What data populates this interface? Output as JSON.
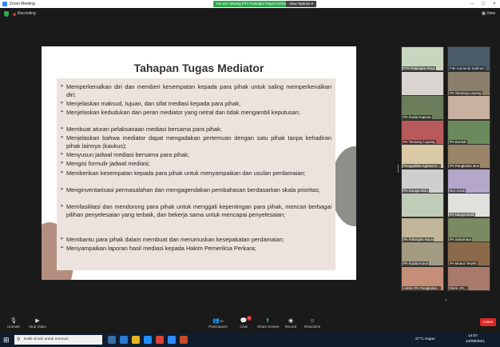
{
  "window": {
    "title": "Zoom Meeting",
    "banner": "You are viewing PTA Palangka Raya's screen",
    "view_options": "View Options",
    "recording": "Recording",
    "view": "View"
  },
  "slide": {
    "title": "Tahapan Tugas Mediator",
    "bullets": [
      "Memperkenalkan diri dan memberi kesempatan kepada para pihak untuk saling memperkenalkan diri;",
      "Menjelaskan maksud, tujuan, dan sifat mediasi kepada para pihak;",
      "Menjelaskan kedudukan dan peran mediator yang netral dan tidak mengambil keputusan;",
      "Membuat aturan pelaksanaan mediasi bersama para pihak;",
      "Menjelaskan bahwa mediator dapat mengadakan pertemuan dengan satu pihak tanpa kehadiran pihak lainnya (kaukus);",
      "Menyusun jadwal mediasi bersama para pihak;",
      "Mengisi formulir jadwal mediasi;",
      "Memberikan kesempatan kepada para pihak untuk menyampaikan dan usulan perdamaian;",
      "Menginventarisasi permasalahan dan mengagendakan pembahasan berdasarkan skala prioritas;",
      "Memfasilitasi dan mendorong para pihak untuk menggali kepentingan para pihak, mencari berbagai pilihan penyelesaian yang terbaik, dan bekerja sama untuk mencapai penyelesaian;",
      "Membantu para pihak dalam membuat dan merumuskan kesepakatan perdamaian;",
      "Menyampaikan laporan hasil mediasi kepada Hakim Pemeriksa Perkara;"
    ]
  },
  "participants": [
    {
      "name": "PTA Palangka Raya",
      "color": "#c8d6c0"
    },
    {
      "name": "Fitri Aumendi Kalimen",
      "color": "#4a5a68"
    },
    {
      "name": "",
      "color": "#d9d4cf"
    },
    {
      "name": "PA Tamiang Layang",
      "color": "#8a7f6a"
    },
    {
      "name": "PA Kuala Kapuas",
      "color": "#6b7d5a"
    },
    {
      "name": "",
      "color": "#c7b19f"
    },
    {
      "name": "PA Tamiang Layang",
      "color": "#b95a5a"
    },
    {
      "name": "PA Buntok",
      "color": "#6b8a5b"
    },
    {
      "name": "Pengadilan Agama K...",
      "color": "#d9c9a5"
    },
    {
      "name": "PA Pangkalan Bun",
      "color": "#9a8569"
    },
    {
      "name": "PA Sungai Bulu",
      "color": "#cfcfcf"
    },
    {
      "name": "Nur Izzah",
      "color": "#b5a7c9"
    },
    {
      "name": "",
      "color": "#c0cbb8"
    },
    {
      "name": "PA Nanga Bulik",
      "color": "#e0e0dc"
    },
    {
      "name": "PA Palangka Raya",
      "color": "#c2b69a"
    },
    {
      "name": "PA Sukamara",
      "color": "#7a8a62"
    },
    {
      "name": "PA Kuala Kurun",
      "color": "#a49b83"
    },
    {
      "name": "PA Muara Teweh",
      "color": "#8a6a4a"
    },
    {
      "name": "Admin PA Pangkalan...",
      "color": "#c48f76"
    },
    {
      "name": "Elem..PA...",
      "color": "#a97a6b"
    }
  ],
  "toolbar": {
    "unmute": "Unmute",
    "stop_video": "Stop Video",
    "participants": "Participants",
    "participants_count": "20",
    "chat": "Chat",
    "chat_badge": "1",
    "share_screen": "Share Screen",
    "record": "Record",
    "reactions": "Reactions",
    "leave": "Leave"
  },
  "taskbar": {
    "search_placeholder": "Ketik di sini untuk mencari",
    "weather": "27°C  Hujan",
    "time": "14:07",
    "date": "24/09/2021"
  }
}
